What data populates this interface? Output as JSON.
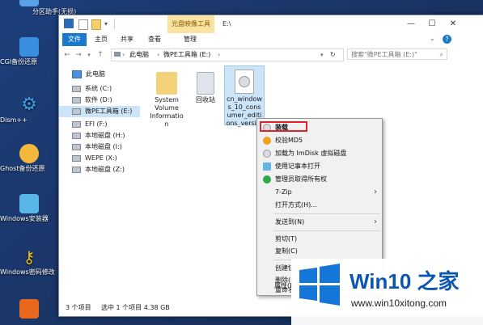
{
  "desktop_icons": [
    {
      "label": "分区助手(无损)",
      "color": "#5aa2e6"
    },
    {
      "label": "CGI备份还原",
      "color": "#3a8ee0"
    },
    {
      "label": "Dism++",
      "color": "#3aa0e8"
    },
    {
      "label": "Ghost备份还原",
      "color": "#f4b93a"
    },
    {
      "label": "Windows安装器",
      "color": "#59b7e8"
    },
    {
      "label": "Windows密码修改",
      "color": "#f0c020"
    },
    {
      "label": "",
      "color": "#e8691e"
    }
  ],
  "window": {
    "context_tab": "光盘映像工具",
    "title": "E:\\",
    "minimize": "—",
    "maximize": "☐",
    "close": "✕",
    "ribbon_tabs": [
      "文件",
      "主页",
      "共享",
      "查看",
      "管理"
    ],
    "help": "?",
    "path": [
      "此电脑",
      "微PE工具箱 (E:)"
    ],
    "search_placeholder": "搜索\"微PE工具箱 (E:)\""
  },
  "nav": {
    "pc": "此电脑",
    "drives": [
      "系统 (C:)",
      "软件 (D:)",
      "微PE工具箱 (E:)",
      "EFI (F:)",
      "本地磁盘 (H:)",
      "本地磁盘 (I:)",
      "WEPE (X:)",
      "本地磁盘 (Z:)"
    ]
  },
  "files": [
    {
      "name": "System Volume Information",
      "lines": [
        "System",
        "Volume",
        "Informatio",
        "n"
      ]
    },
    {
      "name": "回收站",
      "lines": [
        "回收站"
      ]
    },
    {
      "name": "cn_windows_10_consumer_editions_versi...",
      "lines": [
        "cn_window",
        "s_10_cons",
        "umer_editi",
        "ons_versi..."
      ]
    }
  ],
  "status": {
    "count": "3 个项目",
    "selected": "选中 1 个项目  4.38 GB"
  },
  "context_menu": {
    "items": [
      {
        "label": "装载",
        "icon": "disc"
      },
      {
        "label": "校验MD5",
        "icon": "shield-orange"
      },
      {
        "label": "加载为 ImDisk 虚拟磁盘",
        "icon": "disc"
      },
      {
        "label": "使用记事本打开",
        "icon": "notepad"
      },
      {
        "label": "管理员取得所有权",
        "icon": "shield-green"
      },
      {
        "label": "7-Zip",
        "arrow": "›"
      },
      {
        "label": "打开方式(H)..."
      },
      {
        "label": "发送到(N)",
        "arrow": "›"
      },
      {
        "label": "剪切(T)"
      },
      {
        "label": "复制(C)"
      },
      {
        "label": "创建快捷方式(S)"
      },
      {
        "label": "删除(D)"
      },
      {
        "label": "重命名(M)"
      },
      {
        "label": "属性(R)"
      }
    ]
  },
  "watermark": {
    "title": "Win10 之家",
    "url": "www.win10xitong.com"
  },
  "colors": {
    "accent": "#1979ca",
    "highlight": "#e0222c",
    "brand": "#0b56b3"
  }
}
